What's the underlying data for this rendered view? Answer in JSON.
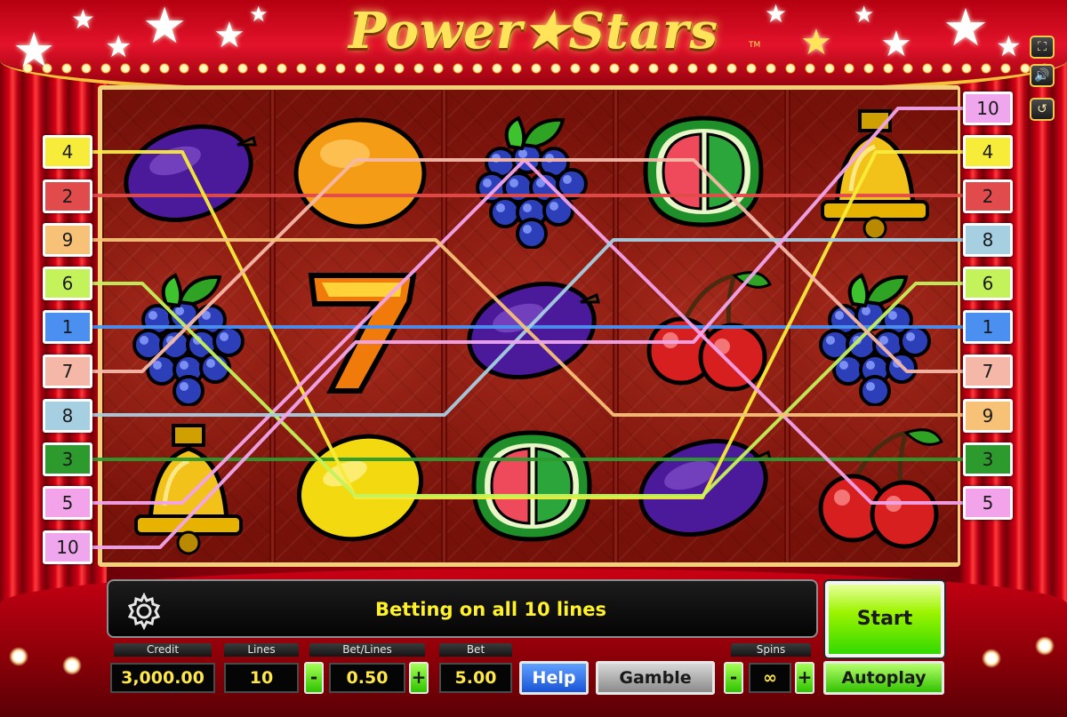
{
  "game": {
    "title": "Power★Stars",
    "trademark": "TM"
  },
  "toolbar": {
    "fullscreen_icon": "fullscreen-icon",
    "sound_icon": "speaker-icon",
    "history_icon": "history-icon"
  },
  "reels": [
    [
      "plum",
      "grapes",
      "bell"
    ],
    [
      "orange",
      "seven",
      "lemon"
    ],
    [
      "grapes",
      "plum",
      "watermelon"
    ],
    [
      "watermelon",
      "cherries",
      "plum"
    ],
    [
      "bell",
      "grapes",
      "cherries"
    ]
  ],
  "lines": {
    "left": [
      {
        "num": "4",
        "color": "#f7ec3a"
      },
      {
        "num": "2",
        "color": "#e24b4b"
      },
      {
        "num": "9",
        "color": "#f7c178"
      },
      {
        "num": "6",
        "color": "#c4f25a"
      },
      {
        "num": "1",
        "color": "#4b8ff0"
      },
      {
        "num": "7",
        "color": "#f5b8a8"
      },
      {
        "num": "8",
        "color": "#a6cfe2"
      },
      {
        "num": "3",
        "color": "#2c9a2c"
      },
      {
        "num": "5",
        "color": "#f2a3ea"
      },
      {
        "num": "10",
        "color": "#f0a6ec"
      }
    ],
    "right": [
      {
        "num": "10",
        "color": "#f0a6ec"
      },
      {
        "num": "4",
        "color": "#f7ec3a"
      },
      {
        "num": "2",
        "color": "#e24b4b"
      },
      {
        "num": "8",
        "color": "#a6cfe2"
      },
      {
        "num": "6",
        "color": "#c4f25a"
      },
      {
        "num": "1",
        "color": "#4b8ff0"
      },
      {
        "num": "7",
        "color": "#f5b8a8"
      },
      {
        "num": "9",
        "color": "#f7c178"
      },
      {
        "num": "3",
        "color": "#2c9a2c"
      },
      {
        "num": "5",
        "color": "#f2a3ea"
      }
    ]
  },
  "status": {
    "message": "Betting on all 10 lines",
    "settings_icon": "gear-icon"
  },
  "controls": {
    "credit_label": "Credit",
    "credit_value": "3,000.00",
    "lines_label": "Lines",
    "lines_value": "10",
    "betlines_label": "Bet/Lines",
    "betlines_value": "0.50",
    "bet_label": "Bet",
    "bet_value": "5.00",
    "spins_label": "Spins",
    "spins_value": "∞",
    "minus": "-",
    "plus": "+",
    "help": "Help",
    "gamble": "Gamble",
    "autoplay": "Autoplay",
    "start": "Start"
  },
  "colors": {
    "message_text": "#fff12a",
    "value_text": "#ffe74a",
    "start_green": "#6ee000",
    "frame_gold": "#f4d079"
  }
}
